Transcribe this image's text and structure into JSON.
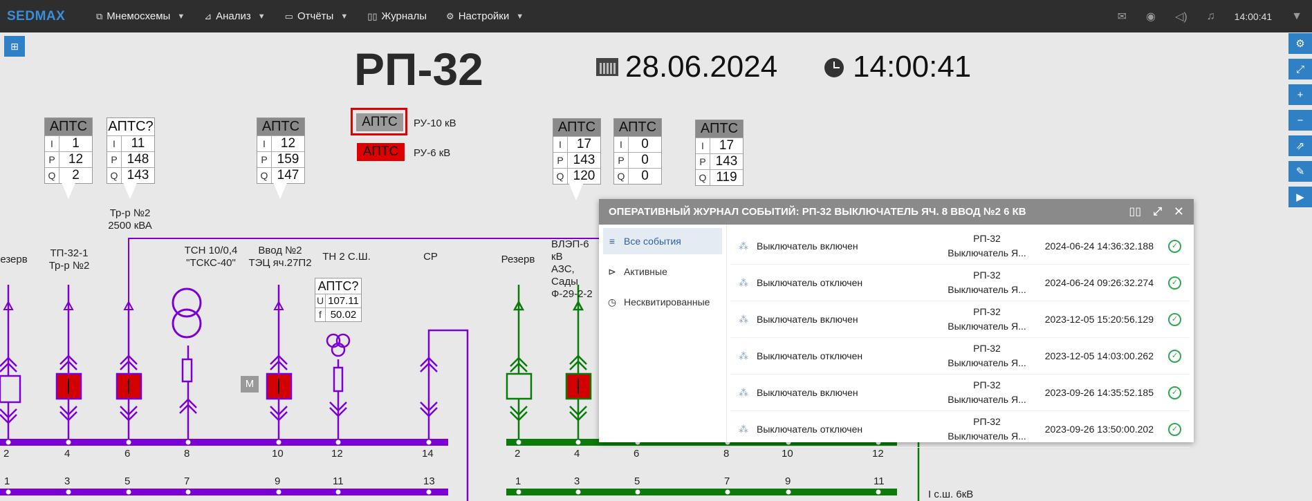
{
  "app": {
    "logo": "SEDMAX",
    "menu": [
      {
        "label": "Мнемосхемы",
        "icon": "mnemo-icon",
        "has_dropdown": true
      },
      {
        "label": "Анализ",
        "icon": "chart-icon",
        "has_dropdown": true
      },
      {
        "label": "Отчёты",
        "icon": "folder-icon",
        "has_dropdown": true
      },
      {
        "label": "Журналы",
        "icon": "book-icon",
        "has_dropdown": false
      },
      {
        "label": "Настройки",
        "icon": "gear-icon",
        "has_dropdown": true
      }
    ],
    "clock": "14:00:41"
  },
  "scheme": {
    "title": "РП-32",
    "date": "28.06.2024",
    "time": "14:00:41",
    "aptc_blocks": [
      {
        "header": "АПТС",
        "rows": [
          {
            "k": "I",
            "v": "1"
          },
          {
            "k": "P",
            "v": "12"
          },
          {
            "k": "Q",
            "v": "2"
          }
        ]
      },
      {
        "header": "АПТС?",
        "rows": [
          {
            "k": "I",
            "v": "11"
          },
          {
            "k": "P",
            "v": "148"
          },
          {
            "k": "Q",
            "v": "143"
          }
        ]
      },
      {
        "header": "АПТС",
        "rows": [
          {
            "k": "I",
            "v": "12"
          },
          {
            "k": "P",
            "v": "159"
          },
          {
            "k": "Q",
            "v": "147"
          }
        ]
      },
      {
        "header": "АПТС",
        "rows": [
          {
            "k": "I",
            "v": "17"
          },
          {
            "k": "P",
            "v": "143"
          },
          {
            "k": "Q",
            "v": "120"
          }
        ]
      },
      {
        "header": "АПТС",
        "rows": [
          {
            "k": "I",
            "v": "0"
          },
          {
            "k": "P",
            "v": "0"
          },
          {
            "k": "Q",
            "v": "0"
          }
        ]
      },
      {
        "header": "АПТС",
        "rows": [
          {
            "k": "I",
            "v": "17"
          },
          {
            "k": "P",
            "v": "143"
          },
          {
            "k": "Q",
            "v": "119"
          }
        ]
      }
    ],
    "aptc_uf": {
      "header": "АПТС?",
      "rows": [
        {
          "k": "U",
          "v": "107.11"
        },
        {
          "k": "f",
          "v": "50.02"
        }
      ]
    },
    "status": [
      {
        "button": "АПТС",
        "label": "РУ-10 кВ",
        "color": "#9a9a9a"
      },
      {
        "button": "АПТС",
        "label": "РУ-6 кВ",
        "color": "#e00000"
      }
    ],
    "feeder_labels": [
      "езерв",
      "ТП-32-1\nТр-р №2",
      "Тр-р №2\n2500 кВА",
      "ТСН 10/0,4\n\"ТСКС-40\"",
      "Ввод №2\nТЭЦ яч.27П2",
      "ТН 2 С.Ш.",
      "СР",
      "Резерв",
      "ВЛЭП-6 кВ\nАЗС, Сады\nФ-29-2-2"
    ],
    "m_label": "M",
    "bus_top_left": [
      "2",
      "4",
      "6",
      "8",
      "10",
      "12",
      "14"
    ],
    "bus_bottom_left": [
      "1",
      "3",
      "5",
      "7",
      "9",
      "11",
      "13"
    ],
    "bus_top_right": [
      "2",
      "4",
      "6",
      "8",
      "10",
      "12"
    ],
    "bus_bottom_right": [
      "1",
      "3",
      "5",
      "7",
      "9",
      "11"
    ],
    "section_label": "I с.ш. 6кВ",
    "colors": {
      "bus_10kv": "#7b00d6",
      "bus_6kv": "#0a7a0a",
      "breaker_on": "#d40000"
    }
  },
  "journal": {
    "title": "ОПЕРАТИВНЫЙ ЖУРНАЛ СОБЫТИЙ: РП-32 ВЫКЛЮЧАТЕЛЬ ЯЧ. 8 ВВОД №2 6 КВ",
    "filters": [
      {
        "label": "Все события",
        "icon": "list-icon",
        "active": true
      },
      {
        "label": "Активные",
        "icon": "play-icon",
        "active": false
      },
      {
        "label": "Несквитированные",
        "icon": "history-icon",
        "active": false
      }
    ],
    "events": [
      {
        "message": "Выключатель включен",
        "object_line1": "РП-32",
        "object_line2": "Выключатель Я...",
        "timestamp": "2024-06-24 14:36:32.188"
      },
      {
        "message": "Выключатель отключен",
        "object_line1": "РП-32",
        "object_line2": "Выключатель Я...",
        "timestamp": "2024-06-24 09:26:32.274"
      },
      {
        "message": "Выключатель включен",
        "object_line1": "РП-32",
        "object_line2": "Выключатель Я...",
        "timestamp": "2023-12-05 15:20:56.129"
      },
      {
        "message": "Выключатель отключен",
        "object_line1": "РП-32",
        "object_line2": "Выключатель Я...",
        "timestamp": "2023-12-05 14:03:00.262"
      },
      {
        "message": "Выключатель включен",
        "object_line1": "РП-32",
        "object_line2": "Выключатель Я...",
        "timestamp": "2023-09-26 14:35:52.185"
      },
      {
        "message": "Выключатель отключен",
        "object_line1": "РП-32",
        "object_line2": "Выключатель Я...",
        "timestamp": "2023-09-26 13:50:00.202"
      }
    ]
  }
}
